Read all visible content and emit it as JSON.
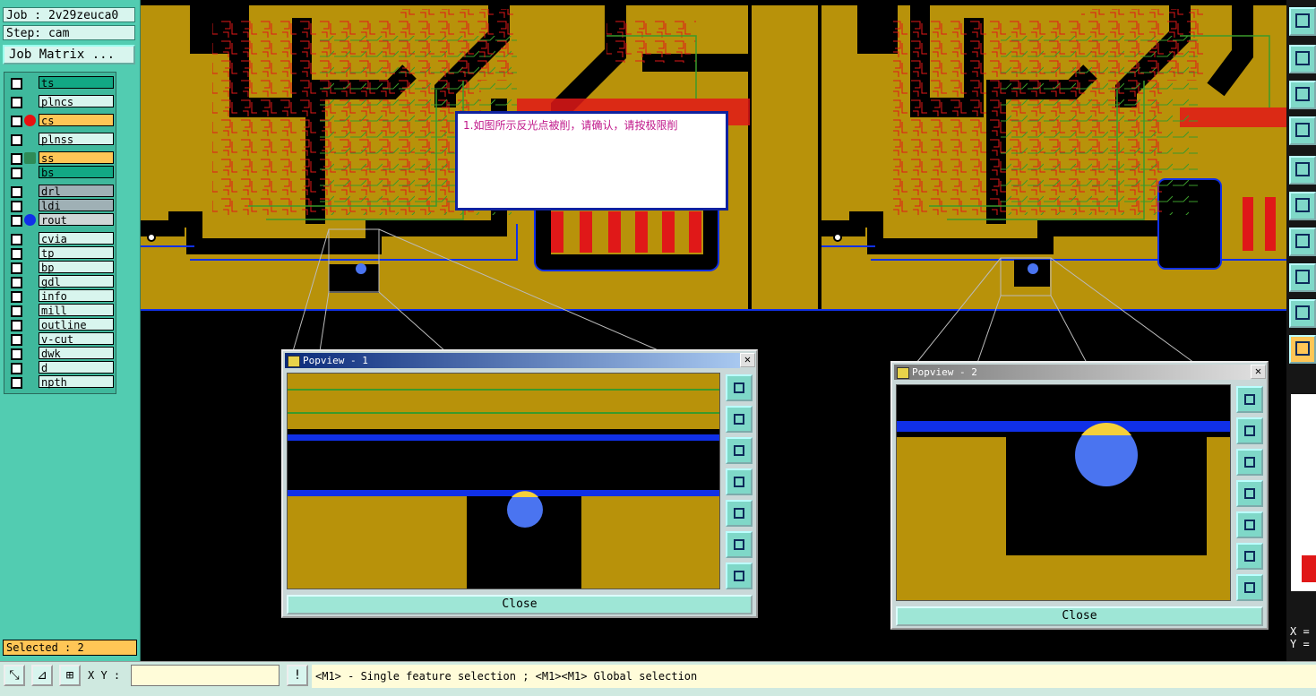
{
  "left_panel": {
    "job_label": "Job : 2v29zeuca0",
    "step_label": "Step: cam",
    "job_matrix_label": "Job Matrix ...",
    "layers": [
      {
        "name": "ts",
        "style": "green",
        "dot": ""
      },
      {
        "name": "plncs",
        "style": "light",
        "dot": ""
      },
      {
        "name": "cs",
        "style": "orange",
        "dot": "#e81010"
      },
      {
        "name": "plnss",
        "style": "light",
        "dot": ""
      },
      {
        "name": "ss",
        "style": "orange",
        "dot": "edit"
      },
      {
        "name": "bs",
        "style": "green",
        "dot": ""
      },
      {
        "name": "drl",
        "style": "gray",
        "dot": ""
      },
      {
        "name": "ldi",
        "style": "gray",
        "dot": ""
      },
      {
        "name": "rout",
        "style": "silver",
        "dot": "#1030e8"
      },
      {
        "name": "cvia",
        "style": "light",
        "dot": ""
      },
      {
        "name": "tp",
        "style": "light",
        "dot": ""
      },
      {
        "name": "bp",
        "style": "light",
        "dot": ""
      },
      {
        "name": "gdl",
        "style": "light",
        "dot": ""
      },
      {
        "name": "info",
        "style": "light",
        "dot": ""
      },
      {
        "name": "mill",
        "style": "light",
        "dot": ""
      },
      {
        "name": "outline",
        "style": "light",
        "dot": ""
      },
      {
        "name": "v-cut",
        "style": "light",
        "dot": ""
      },
      {
        "name": "dwk",
        "style": "light",
        "dot": ""
      },
      {
        "name": "d",
        "style": "light",
        "dot": ""
      },
      {
        "name": "npth",
        "style": "light",
        "dot": ""
      }
    ],
    "selected_label": "Selected : 2"
  },
  "note": {
    "text": "1.如图所示反光点被削，请确认，请按极限削"
  },
  "popviews": [
    {
      "title": "Popview - 1",
      "close_label": "Close"
    },
    {
      "title": "Popview - 2",
      "close_label": "Close"
    }
  ],
  "bottom_bar": {
    "xy_label": "X Y :",
    "xy_value": "",
    "alert_icon": "!",
    "status_message": "<M1> - Single feature selection ; <M1><M1> Global selection"
  },
  "right_panel": {
    "coord_x": "X =",
    "coord_y": "Y ="
  },
  "colors": {
    "copper": "#b8920a",
    "trace_red": "#e01818",
    "trace_green": "#3a9a2a",
    "outline_blue": "#1030e8",
    "pad_blue": "#4a74f0",
    "panel_teal": "#52ccb1",
    "highlight_orange": "#ffc656"
  }
}
